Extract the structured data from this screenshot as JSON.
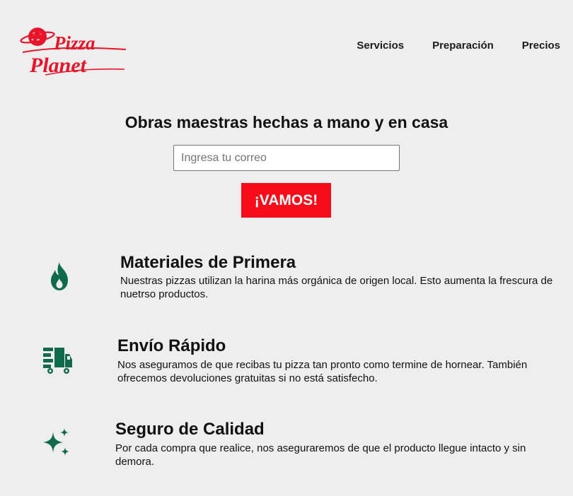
{
  "brand": {
    "logo_line1": "Pizza",
    "logo_line2": "Planet",
    "color": "#e8142a"
  },
  "nav": {
    "items": [
      {
        "label": "Servicios"
      },
      {
        "label": "Preparación"
      },
      {
        "label": "Precios"
      }
    ]
  },
  "hero": {
    "title": "Obras maestras hechas a mano y en casa",
    "email_placeholder": "Ingresa tu correo",
    "email_value": "",
    "button_label": "¡VAMOS!",
    "button_color": "#f70d1a"
  },
  "features": {
    "icon_color": "#0f6b4c",
    "items": [
      {
        "icon": "fire-icon",
        "title": "Materiales de Primera",
        "text": "Nuestras pizzas utilizan la harina más orgánica de origen local. Esto aumenta la frescura de nuetrso productos."
      },
      {
        "icon": "shipping-fast-icon",
        "title": "Envío Rápido",
        "text": "Nos aseguramos de que recibas tu pizza tan pronto como termine de hornear. También ofrecemos devoluciones gratuitas si no está satisfecho."
      },
      {
        "icon": "sparkles-icon",
        "title": "Seguro de Calidad",
        "text": "Por cada compra que realice, nos aseguraremos de que el producto llegue intacto y sin demora."
      }
    ]
  }
}
